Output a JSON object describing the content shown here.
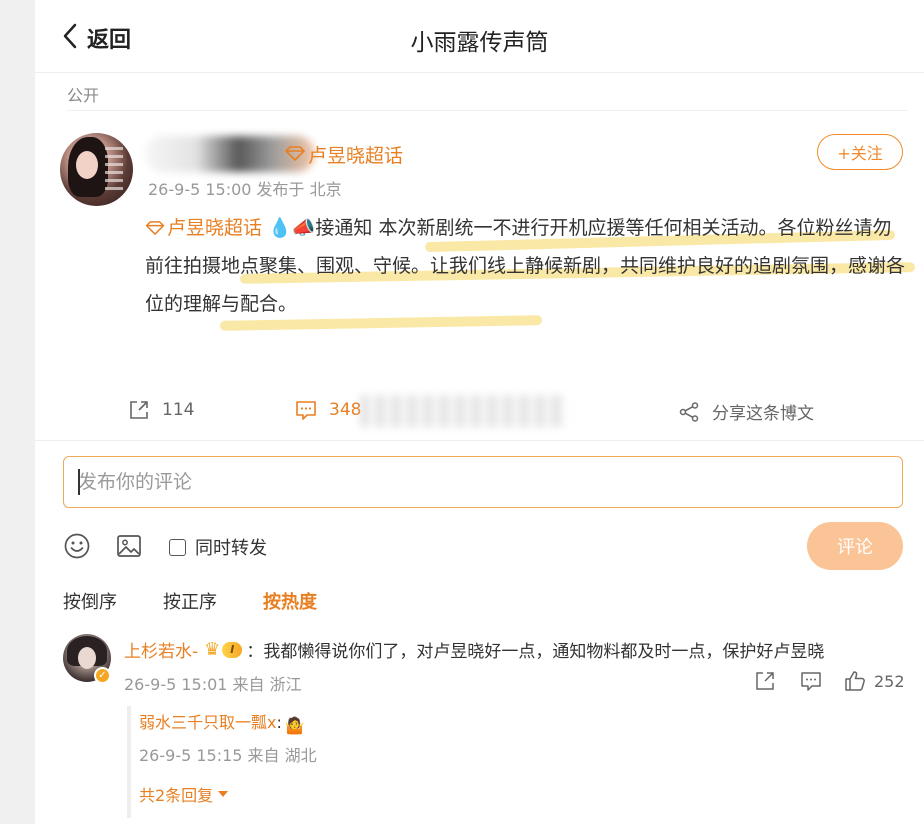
{
  "header": {
    "back_label": "返回",
    "title": "小雨露传声筒"
  },
  "visibility": "公开",
  "post": {
    "topic_tag": "卢昱晓超话",
    "meta": "26-9-5 15:00 发布于 北京",
    "follow_label": "+关注",
    "body_topic": "卢昱晓超话",
    "body_emoji_drop": "💧",
    "body_emoji_horn": "📣",
    "body_text": "接通知 本次新剧统一不进行开机应援等任何相关活动。各位粉丝请勿前往拍摄地点聚集、围观、守候。让我们线上静候新剧，共同维护良好的追剧氛围，感谢各位的理解与配合。"
  },
  "actions": {
    "repost_count": "114",
    "comment_count": "348",
    "share_label": "分享这条博文"
  },
  "composer": {
    "placeholder": "发布你的评论",
    "repost_label": "同时转发",
    "submit_label": "评论"
  },
  "sort": {
    "reverse": "按倒序",
    "forward": "按正序",
    "hot": "按热度"
  },
  "comments": [
    {
      "user": "上杉若水-",
      "level": "I",
      "text": "：我都懒得说你们了，对卢昱晓好一点，通知物料都及时一点，保护好卢昱晓",
      "meta": "26-9-5 15:01 来自 浙江",
      "likes": "252",
      "reply": {
        "user": "弱水三千只取一瓢x",
        "text": ":",
        "emoji": "🤷",
        "meta": "26-9-5 15:15 来自 湖北"
      },
      "more_replies": "共2条回复"
    }
  ],
  "colors": {
    "accent": "#e87f22",
    "button_disabled": "#fbc497",
    "highlight": "#f5cd3c"
  }
}
